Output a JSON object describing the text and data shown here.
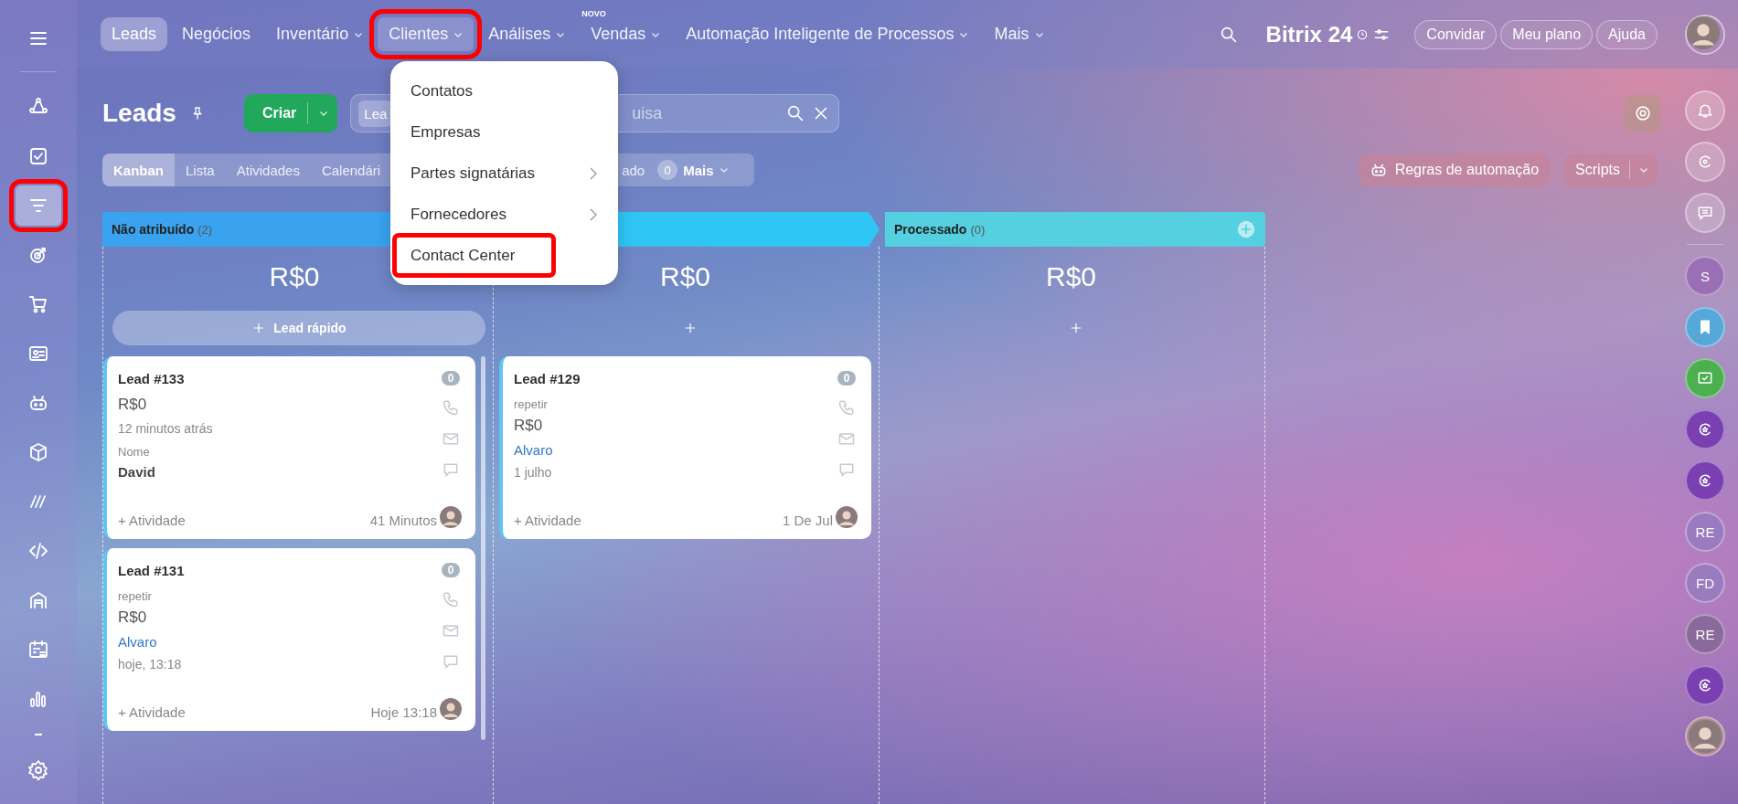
{
  "top_nav": {
    "items": [
      {
        "label": "Leads",
        "selected": true,
        "dropdown": false,
        "highlighted": false
      },
      {
        "label": "Negócios",
        "selected": false,
        "dropdown": false,
        "highlighted": false
      },
      {
        "label": "Inventário",
        "selected": false,
        "dropdown": true,
        "highlighted": false
      },
      {
        "label": "Clientes",
        "selected": false,
        "dropdown": true,
        "highlighted": true,
        "open": true
      },
      {
        "label": "Análises",
        "selected": false,
        "dropdown": true,
        "highlighted": false
      },
      {
        "label": "Vendas",
        "selected": false,
        "dropdown": true,
        "highlighted": false,
        "badge": "NOVO"
      },
      {
        "label": "Automação Inteligente de Processos",
        "selected": false,
        "dropdown": true,
        "highlighted": false
      },
      {
        "label": "Mais",
        "selected": false,
        "dropdown": true,
        "highlighted": false
      }
    ],
    "logo": "Bitrix 24",
    "buttons": [
      "Convidar",
      "Meu plano",
      "Ajuda"
    ]
  },
  "dropdown_menu": {
    "items": [
      {
        "label": "Contatos",
        "submenu": false,
        "highlighted": false
      },
      {
        "label": "Empresas",
        "submenu": false,
        "highlighted": false
      },
      {
        "label": "Partes signatárias",
        "submenu": true,
        "highlighted": false
      },
      {
        "label": "Fornecedores",
        "submenu": true,
        "highlighted": false
      },
      {
        "label": "Contact Center",
        "submenu": false,
        "highlighted": true
      }
    ]
  },
  "sidebar": {
    "items": [
      {
        "selected": false,
        "highlighted": false
      },
      {
        "selected": false,
        "highlighted": false
      },
      {
        "selected": true,
        "highlighted": true
      },
      {
        "selected": false,
        "highlighted": false
      },
      {
        "selected": false,
        "highlighted": false
      },
      {
        "selected": false,
        "highlighted": false
      },
      {
        "selected": false,
        "highlighted": false
      },
      {
        "selected": false,
        "highlighted": false
      },
      {
        "selected": false,
        "highlighted": false
      },
      {
        "selected": false,
        "highlighted": false
      },
      {
        "selected": false,
        "highlighted": false
      },
      {
        "selected": false,
        "highlighted": false
      },
      {
        "selected": false,
        "highlighted": false
      }
    ]
  },
  "header": {
    "title": "Leads",
    "create_button": "Criar",
    "search_chip": "Lea",
    "search_placeholder": "uisa"
  },
  "view_tabs": [
    {
      "label": "Kanban",
      "selected": true
    },
    {
      "label": "Lista",
      "selected": false
    },
    {
      "label": "Atividades",
      "selected": false
    },
    {
      "label": "Calendári",
      "selected": false
    }
  ],
  "filter_fragment": "ado",
  "filter_counter": "0",
  "more_button": "Mais",
  "automation_button": "Regras de automação",
  "scripts_button": "Scripts",
  "columns": [
    {
      "title": "Não atribuído",
      "count": "(2)",
      "color": "#3aa3ef",
      "total": "R$0",
      "add_label": "Lead rápido",
      "cards": [
        {
          "title": "Lead #133",
          "counter": "0",
          "lines": [
            {
              "kind": "amount",
              "text": "R$0"
            },
            {
              "kind": "muted",
              "text": "12 minutos atrás"
            },
            {
              "kind": "label",
              "text": "Nome"
            },
            {
              "kind": "value",
              "text": "David"
            }
          ],
          "activity": "+ Atividade",
          "time": "41 Minutos"
        },
        {
          "title": "Lead #131",
          "counter": "0",
          "lines": [
            {
              "kind": "label",
              "text": "repetir"
            },
            {
              "kind": "amount",
              "text": "R$0"
            },
            {
              "kind": "link",
              "text": "Alvaro"
            },
            {
              "kind": "muted",
              "text": "hoje, 13:18"
            }
          ],
          "activity": "+ Atividade",
          "time": "Hoje 13:18"
        }
      ]
    },
    {
      "color": "#2fc6f6",
      "total": "R$0",
      "cards": [
        {
          "title": "Lead #129",
          "counter": "0",
          "lines": [
            {
              "kind": "label",
              "text": "repetir"
            },
            {
              "kind": "amount",
              "text": "R$0"
            },
            {
              "kind": "link",
              "text": "Alvaro"
            },
            {
              "kind": "muted",
              "text": "1 julho"
            }
          ],
          "activity": "+ Atividade",
          "time": "1 De Jul"
        }
      ]
    },
    {
      "title": "Processado",
      "count": "(0)",
      "color": "#55d0e0",
      "total": "R$0",
      "header_add": true
    }
  ],
  "right_bar": {
    "items": [
      {
        "kind": "initials",
        "text": "S",
        "color": "#9b6fb5"
      },
      {
        "kind": "bookmark",
        "color": "#55a8d8"
      },
      {
        "kind": "check",
        "color": "#4caf50"
      },
      {
        "kind": "copilot",
        "color": "#7a3fb0"
      },
      {
        "kind": "copilot",
        "color": "#7a3fb0"
      },
      {
        "kind": "initials",
        "text": "RE",
        "color": "#9b7bc0"
      },
      {
        "kind": "initials",
        "text": "FD",
        "color": "#9b7bc0"
      },
      {
        "kind": "initials",
        "text": "RE",
        "color": "#8a6a9a"
      },
      {
        "kind": "copilot",
        "color": "#7a3fb0"
      },
      {
        "kind": "avatar",
        "color": "#b08898"
      }
    ]
  }
}
